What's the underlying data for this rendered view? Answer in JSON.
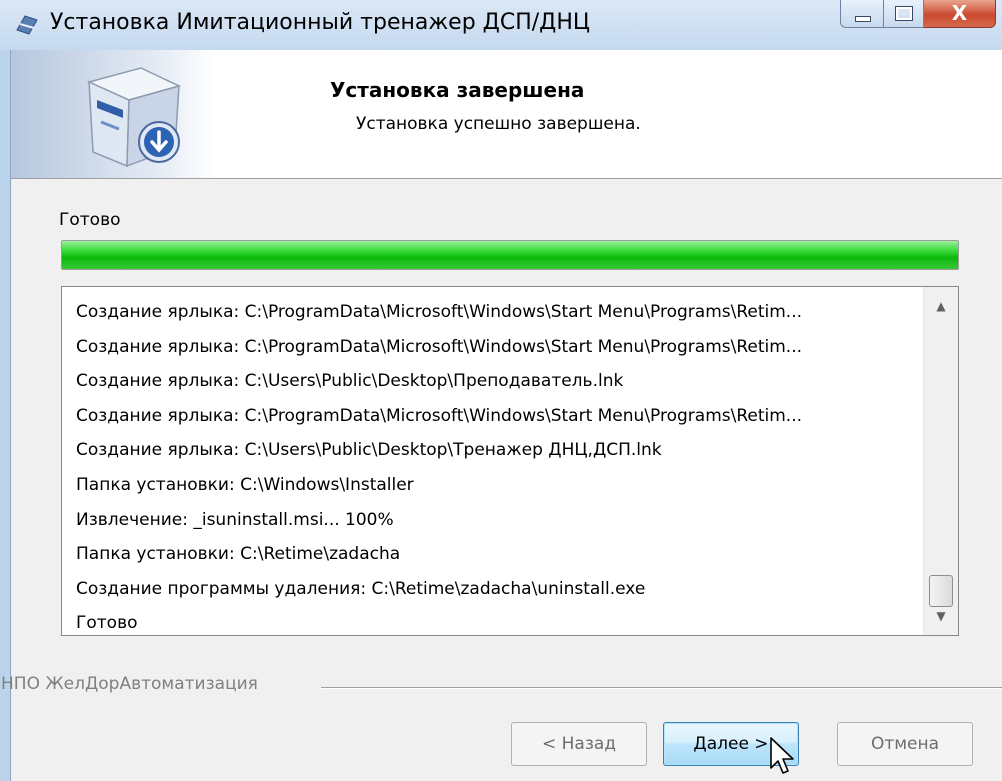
{
  "window": {
    "title": "Установка Имитационный тренажер ДСП/ДНЦ",
    "close_glyph": "X"
  },
  "header": {
    "title": "Установка завершена",
    "subtitle": "Установка успешно завершена."
  },
  "status": {
    "label": "Готово",
    "progress_percent": 100
  },
  "log": {
    "items": [
      "Создание ярлыка: C:\\ProgramData\\Microsoft\\Windows\\Start Menu\\Programs\\Retim...",
      "Создание ярлыка: C:\\ProgramData\\Microsoft\\Windows\\Start Menu\\Programs\\Retim...",
      "Создание ярлыка: C:\\Users\\Public\\Desktop\\Преподаватель.lnk",
      "Создание ярлыка: C:\\ProgramData\\Microsoft\\Windows\\Start Menu\\Programs\\Retim...",
      "Создание ярлыка: C:\\Users\\Public\\Desktop\\Тренажер ДНЦ,ДСП.lnk",
      "Папка установки: C:\\Windows\\Installer",
      "Извлечение: _isuninstall.msi... 100%",
      "Папка установки: C:\\Retime\\zadacha",
      "Создание программы удаления: C:\\Retime\\zadacha\\uninstall.exe",
      "Готово"
    ]
  },
  "footer": {
    "company": "НПО ЖелДорАвтоматизация",
    "back_label": "< Назад",
    "next_label": "Далее >",
    "cancel_label": "Отмена"
  },
  "icons": {
    "title": "installer-icon",
    "header": "setup-box-icon",
    "scroll_up": "chevron-up-icon",
    "scroll_down": "chevron-down-icon",
    "cursor": "mouse-pointer-icon"
  },
  "colors": {
    "progress": "#19c319",
    "accent_button": "#3c7fb1",
    "close_button": "#c94a30"
  }
}
